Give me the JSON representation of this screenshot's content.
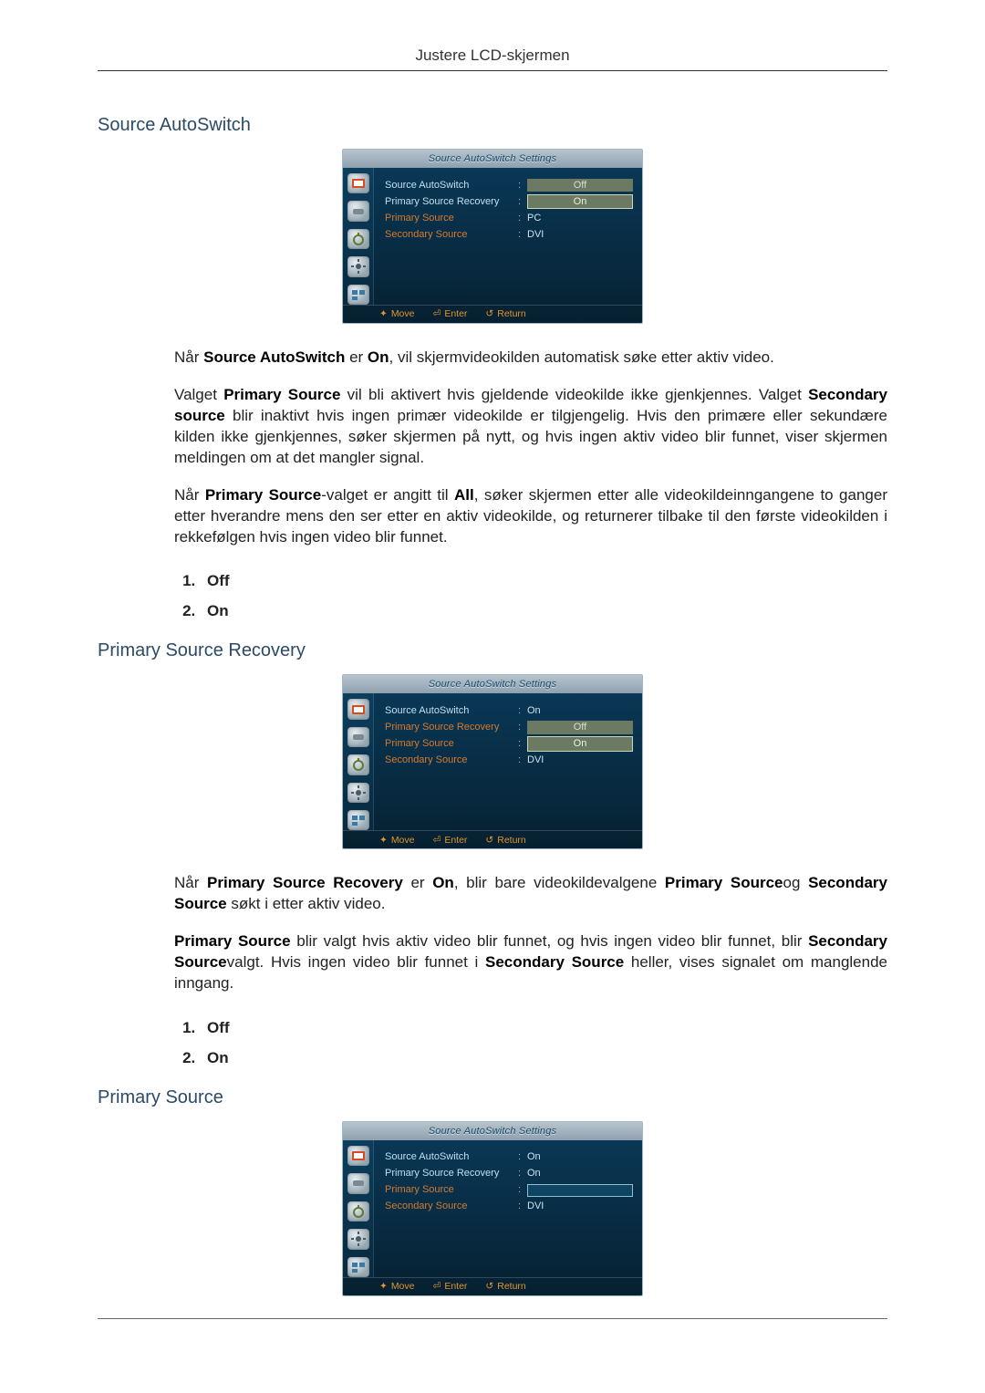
{
  "header": {
    "title": "Justere LCD-skjermen"
  },
  "sections": {
    "s1": {
      "heading": "Source AutoSwitch"
    },
    "s2": {
      "heading": "Primary Source Recovery"
    },
    "s3": {
      "heading": "Primary Source"
    }
  },
  "osd_common": {
    "title": "Source AutoSwitch Settings",
    "rows": {
      "r1": "Source AutoSwitch",
      "r2": "Primary Source Recovery",
      "r3": "Primary Source",
      "r4": "Secondary Source"
    },
    "foot": {
      "move": "Move",
      "enter": "Enter",
      "return": "Return"
    }
  },
  "osd1": {
    "v1": "Off",
    "v1b": "On",
    "v3": "PC",
    "v4": "DVI"
  },
  "osd2": {
    "v1": "On",
    "v2a": "Off",
    "v2b": "On",
    "v4": "DVI"
  },
  "osd3": {
    "v1": "On",
    "v2": "On",
    "v4": "DVI"
  },
  "body1": {
    "p1a": "Når ",
    "p1b": "Source AutoSwitch",
    "p1c": " er ",
    "p1d": "On",
    "p1e": ", vil skjermvideokilden automatisk søke etter aktiv video.",
    "p2a": "Valget ",
    "p2b": "Primary Source",
    "p2c": " vil bli aktivert hvis gjeldende videokilde ikke gjenkjennes. Valget ",
    "p2d": "Secondary source",
    "p2e": " blir inaktivt hvis ingen primær videokilde er tilgjengelig. Hvis den primære eller sekundære kilden ikke gjenkjennes, søker skjermen på nytt, og hvis ingen aktiv video blir funnet, viser skjermen meldingen om at det mangler signal.",
    "p3a": "Når ",
    "p3b": "Primary Source",
    "p3c": "-valget er angitt til ",
    "p3d": "All",
    "p3e": ", søker skjermen etter alle videokildeinngangene to ganger etter hverandre mens den ser etter en aktiv videokilde, og returnerer tilbake til den første videokilden i rekkefølgen hvis ingen video blir funnet.",
    "opt1": "Off",
    "opt2": "On"
  },
  "body2": {
    "p1a": "Når ",
    "p1b": "Primary Source Recovery",
    "p1c": " er ",
    "p1d": "On",
    "p1e": ", blir bare videokildevalgene ",
    "p1f": "Primary Source",
    "p1g": "og ",
    "p1h": "Secondary Source",
    "p1i": " søkt i etter aktiv video.",
    "p2a": "Primary Source",
    "p2b": " blir valgt hvis aktiv video blir funnet, og hvis ingen video blir funnet, blir ",
    "p2c": "Secondary Source",
    "p2d": "valgt. Hvis ingen video blir funnet i ",
    "p2e": "Secondary Source",
    "p2f": " heller, vises signalet om manglende inngang.",
    "opt1": "Off",
    "opt2": "On"
  }
}
